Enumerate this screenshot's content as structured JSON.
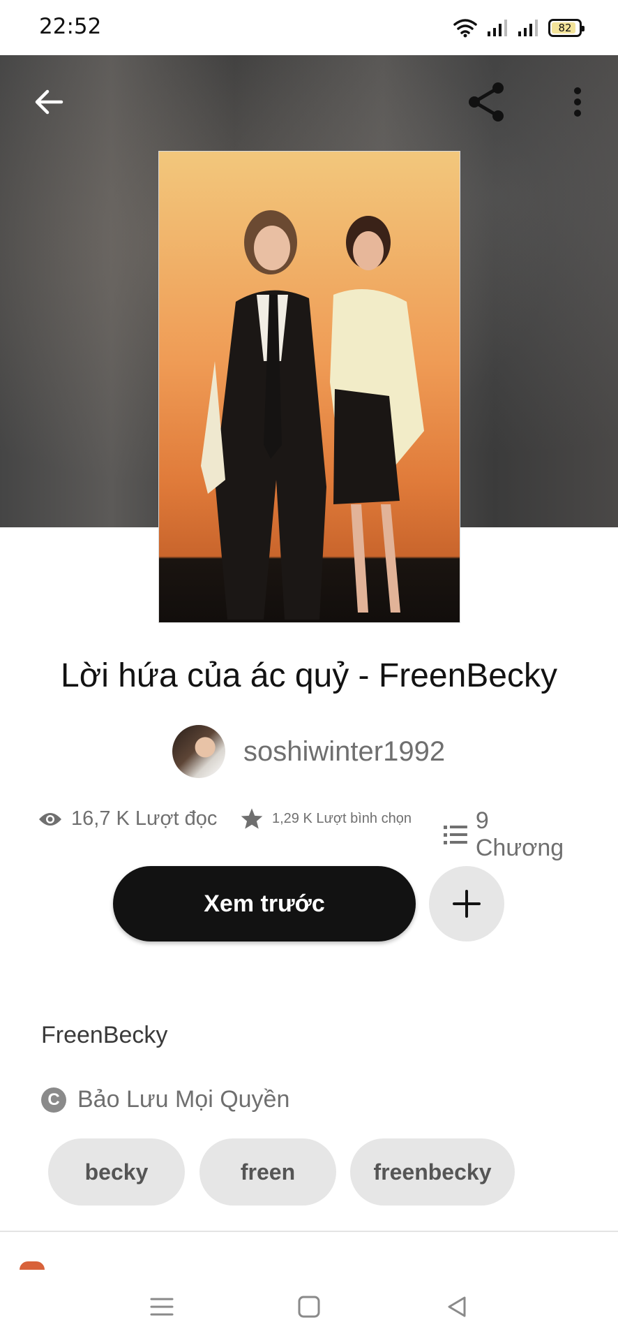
{
  "status_bar": {
    "time": "22:52",
    "battery": "82",
    "icons": [
      "wifi-icon",
      "signal-icon",
      "signal-icon",
      "battery-icon"
    ]
  },
  "header": {
    "icons": [
      "arrow-left-icon",
      "share-icon",
      "more-vertical-icon"
    ]
  },
  "story": {
    "title": "Lời hứa của ác quỷ - FreenBecky",
    "author": "soshiwinter1992",
    "stats": {
      "reads": "16,7 K Lượt đọc",
      "votes": "1,29 K Lượt bình chọn",
      "chapters": "9 Chương"
    },
    "preview_label": "Xem trước",
    "description": "FreenBecky",
    "copyright": "Bảo Lưu Mọi Quyền",
    "tags": [
      "becky",
      "freen",
      "freenbecky"
    ]
  },
  "colors": {
    "primary_button": "#121212",
    "secondary_button": "#e6e6e6",
    "muted_text": "#6f6f6f"
  }
}
